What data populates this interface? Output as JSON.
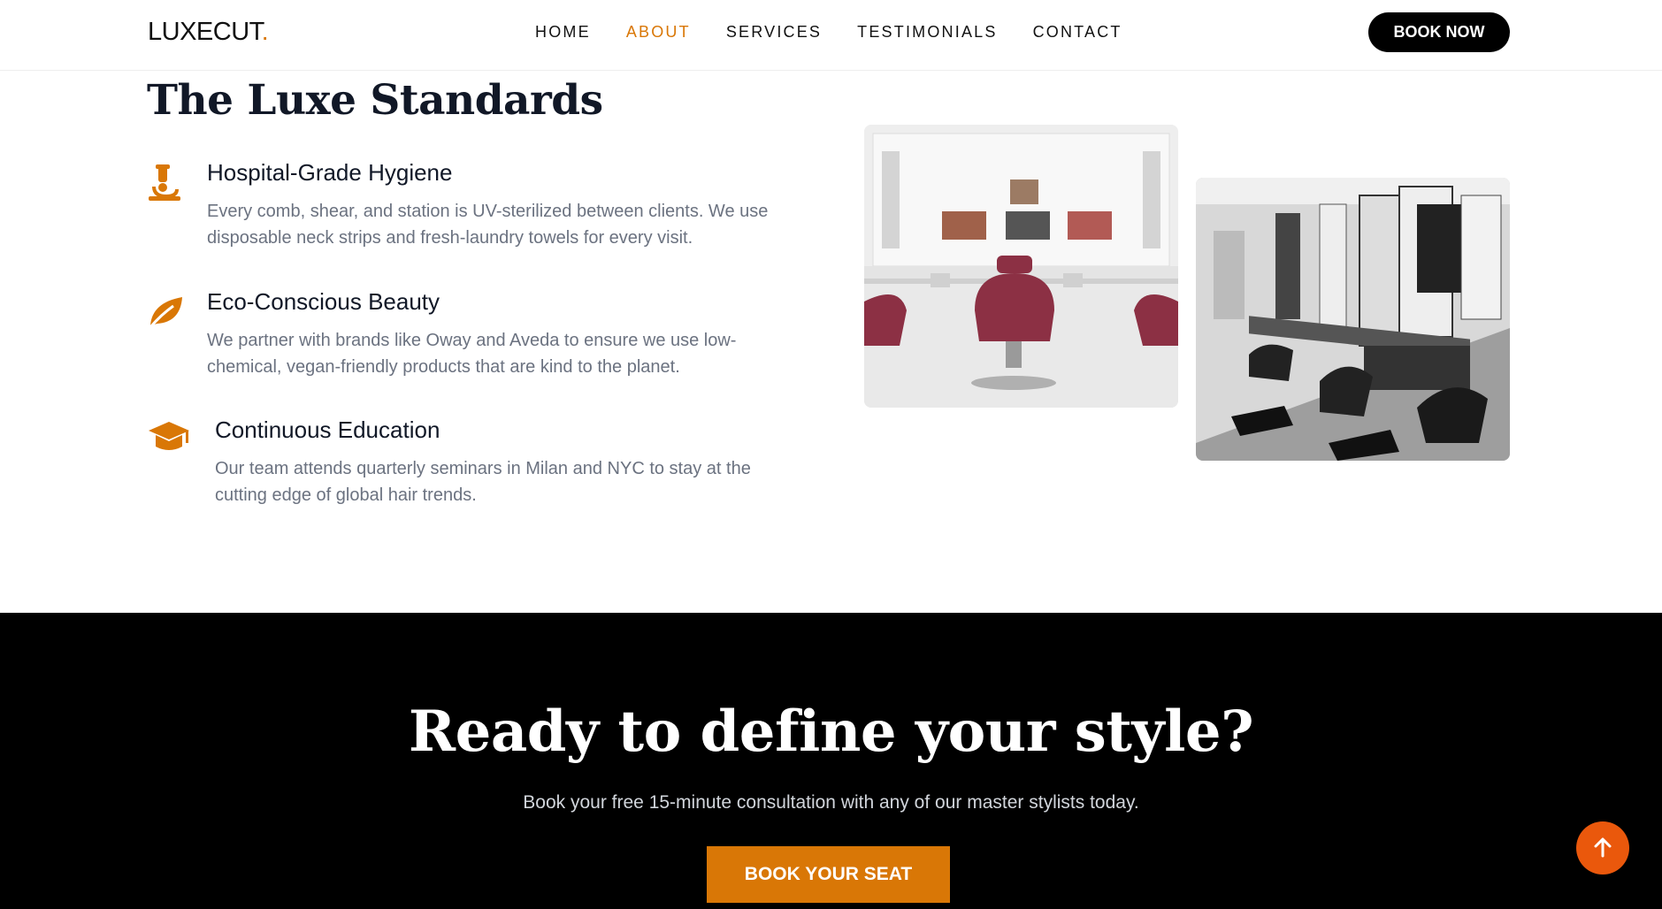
{
  "header": {
    "logo_text": "LUXECUT",
    "logo_dot": ".",
    "nav": [
      {
        "label": "HOME"
      },
      {
        "label": "ABOUT"
      },
      {
        "label": "SERVICES"
      },
      {
        "label": "TESTIMONIALS"
      },
      {
        "label": "CONTACT"
      }
    ],
    "active_nav": "ABOUT",
    "book_now_label": "BOOK NOW"
  },
  "standards": {
    "title": "The Luxe Standards",
    "features": [
      {
        "icon": "microscope-icon",
        "title": "Hospital-Grade Hygiene",
        "description": "Every comb, shear, and station is UV-sterilized between clients. We use disposable neck strips and fresh-laundry towels for every visit."
      },
      {
        "icon": "leaf-icon",
        "title": "Eco-Conscious Beauty",
        "description": "We partner with brands like Oway and Aveda to ensure we use low-chemical, vegan-friendly products that are kind to the planet."
      },
      {
        "icon": "graduation-cap-icon",
        "title": "Continuous Education",
        "description": "Our team attends quarterly seminars in Milan and NYC to stay at the cutting edge of global hair trends."
      }
    ],
    "photos": [
      {
        "name": "salon-interior-color-photo"
      },
      {
        "name": "salon-interior-bw-photo"
      }
    ]
  },
  "cta": {
    "title": "Ready to define your style?",
    "subtitle": "Book your free 15-minute consultation with any of our master stylists today.",
    "button_label": "BOOK YOUR SEAT"
  },
  "colors": {
    "accent": "#d97706",
    "scroll_top": "#ea580c",
    "dark": "#000000"
  }
}
